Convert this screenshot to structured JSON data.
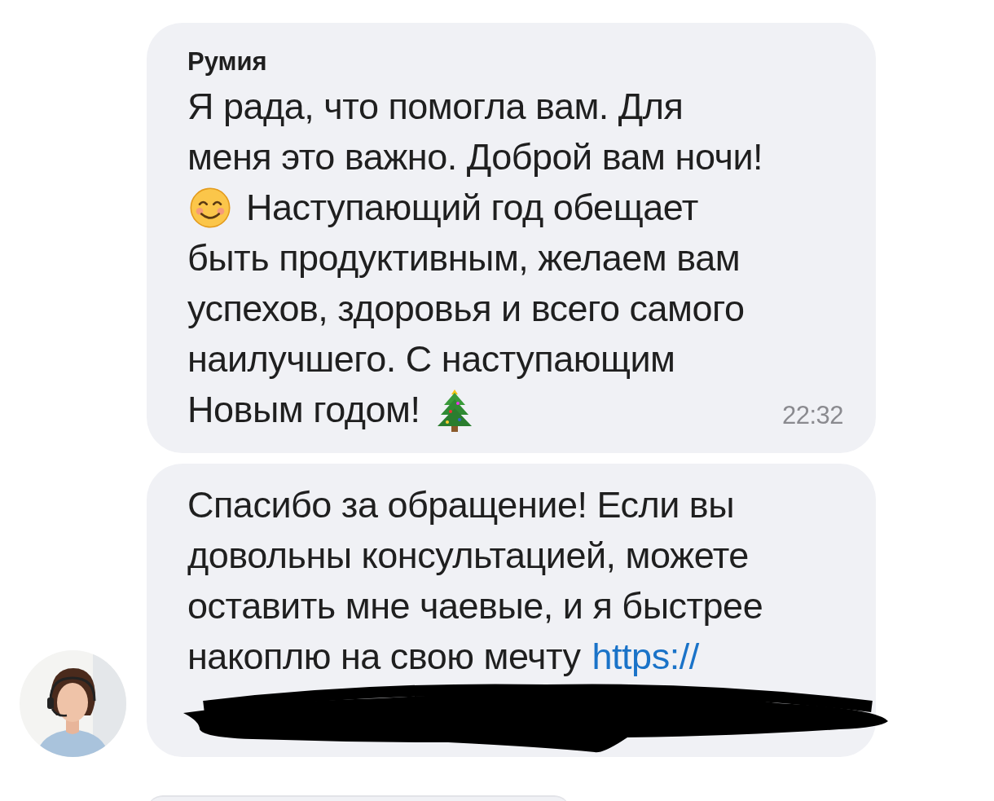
{
  "messages": [
    {
      "sender": "Румия",
      "lines": [
        [
          {
            "kind": "text",
            "text": "Я рада, что помогла вам. Для"
          }
        ],
        [
          {
            "kind": "text",
            "text": "меня это важно. Доброй вам ночи!"
          }
        ],
        [
          {
            "kind": "smiley"
          },
          {
            "kind": "text",
            "text": "Наступающий год обещает"
          }
        ],
        [
          {
            "kind": "text",
            "text": "быть продуктивным, желаем вам"
          }
        ],
        [
          {
            "kind": "text",
            "text": "успехов, здоровья и всего самого"
          }
        ],
        [
          {
            "kind": "text",
            "text": "наилучшего. С наступающим"
          }
        ],
        [
          {
            "kind": "text",
            "text": "Новым годом!"
          },
          {
            "kind": "tree"
          }
        ]
      ],
      "time": "22:32"
    },
    {
      "lines": [
        [
          {
            "kind": "text",
            "text": "Спасибо за обращение! Если вы"
          }
        ],
        [
          {
            "kind": "text",
            "text": "довольны консультацией, можете"
          }
        ],
        [
          {
            "kind": "text",
            "text": "оставить мне чаевые, и я быстрее"
          }
        ],
        [
          {
            "kind": "text",
            "text": "накоплю на свою мечту"
          },
          {
            "kind": "link",
            "text": "https://"
          }
        ]
      ],
      "redacted": true,
      "avatar": {
        "kind": "picture"
      }
    }
  ]
}
